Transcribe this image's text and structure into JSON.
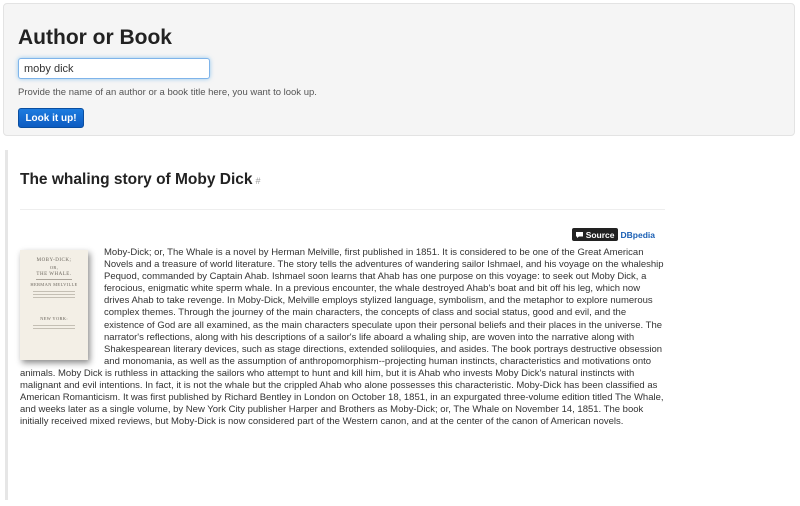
{
  "search": {
    "heading": "Author or Book",
    "input_value": "moby dick",
    "help_text": "Provide the name of an author or a book title here, you want to look up.",
    "button_label": "Look it up!"
  },
  "result": {
    "heading": "The whaling story of Moby Dick",
    "permalink": "#",
    "source_label": "Source",
    "source_link": "DBpedia",
    "cover": {
      "title": "MOBY-DICK;",
      "or": "OR,",
      "subtitle": "THE WHALE.",
      "author": "HERMAN MELVILLE",
      "publisher": "NEW YORK:"
    },
    "description": "Moby-Dick; or, The Whale is a novel by Herman Melville, first published in 1851. It is considered to be one of the Great American Novels and a treasure of world literature. The story tells the adventures of wandering sailor Ishmael, and his voyage on the whaleship Pequod, commanded by Captain Ahab. Ishmael soon learns that Ahab has one purpose on this voyage: to seek out Moby Dick, a ferocious, enigmatic white sperm whale. In a previous encounter, the whale destroyed Ahab's boat and bit off his leg, which now drives Ahab to take revenge. In Moby-Dick, Melville employs stylized language, symbolism, and the metaphor to explore numerous complex themes. Through the journey of the main characters, the concepts of class and social status, good and evil, and the existence of God are all examined, as the main characters speculate upon their personal beliefs and their places in the universe. The narrator's reflections, along with his descriptions of a sailor's life aboard a whaling ship, are woven into the narrative along with Shakespearean literary devices, such as stage directions, extended soliloquies, and asides. The book portrays destructive obsession and monomania, as well as the assumption of anthropomorphism--projecting human instincts, characteristics and motivations onto animals. Moby Dick is ruthless in attacking the sailors who attempt to hunt and kill him, but it is Ahab who invests Moby Dick's natural instincts with malignant and evil intentions. In fact, it is not the whale but the crippled Ahab who alone possesses this characteristic. Moby-Dick has been classified as American Romanticism. It was first published by Richard Bentley in London on October 18, 1851, in an expurgated three-volume edition titled The Whale, and weeks later as a single volume, by New York City publisher Harper and Brothers as Moby-Dick; or, The Whale on November 14, 1851. The book initially received mixed reviews, but Moby-Dick is now considered part of the Western canon, and at the center of the canon of American novels."
  },
  "colors": {
    "button": "#0d5bc1",
    "link": "#1a5fb4",
    "panel": "#f5f5f5"
  }
}
